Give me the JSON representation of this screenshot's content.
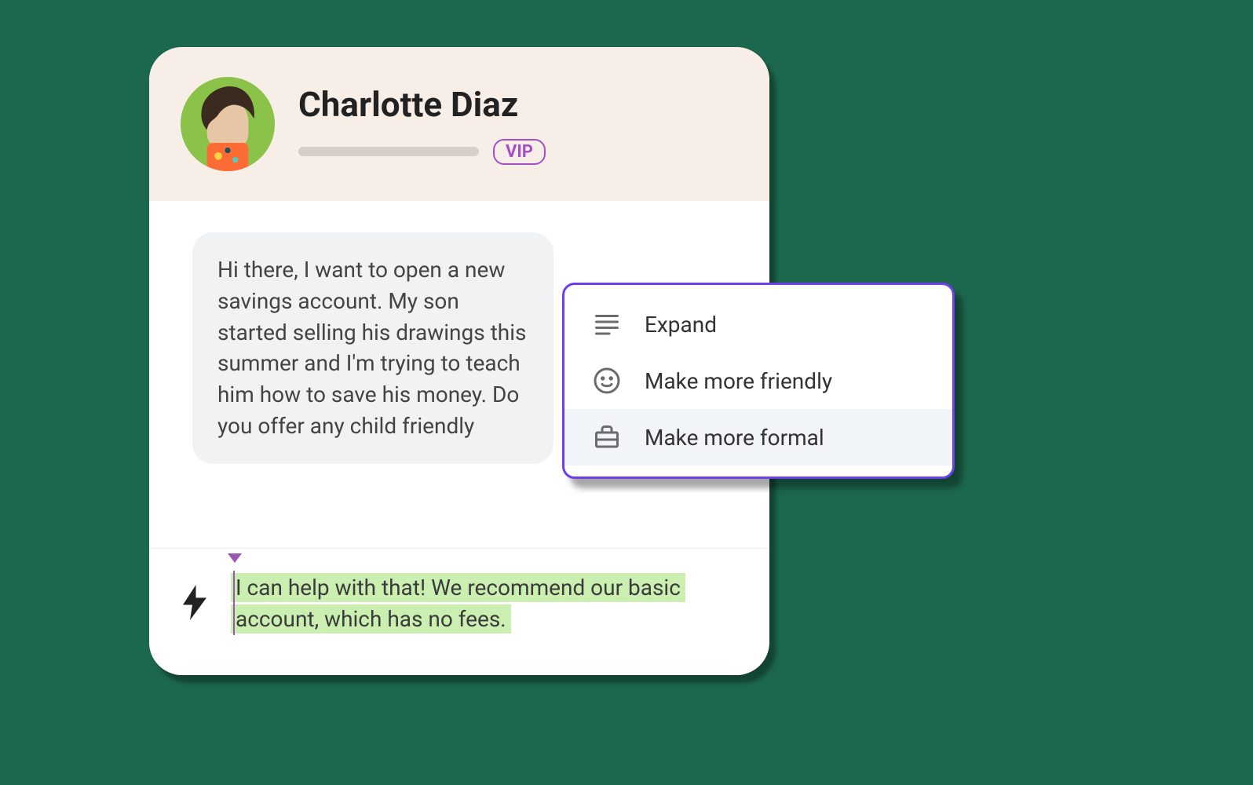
{
  "customer": {
    "name": "Charlotte Diaz",
    "badge": "VIP"
  },
  "message": {
    "body": "Hi there, I want to open a new savings account. My son started selling his drawings this summer and I'm trying to teach him how to save his money. Do you offer any child friendly"
  },
  "compose": {
    "suggested_reply": "I can help with that! We recommend our basic account, which has no fees."
  },
  "suggestions": {
    "items": [
      {
        "label": "Expand",
        "icon": "lines-icon"
      },
      {
        "label": "Make more friendly",
        "icon": "smile-icon"
      },
      {
        "label": "Make more formal",
        "icon": "briefcase-icon"
      }
    ]
  }
}
